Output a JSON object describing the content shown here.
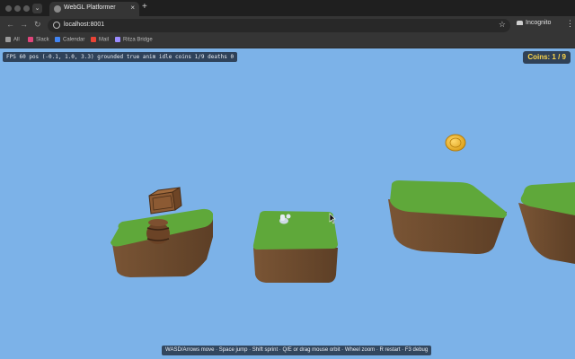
{
  "browser": {
    "tab": {
      "title": "WebGL Platformer",
      "close_glyph": "×"
    },
    "new_tab_glyph": "+",
    "tab_menu_glyph": "⌄",
    "nav": {
      "back": "←",
      "forward": "→",
      "reload": "↻"
    },
    "url": "localhost:8001",
    "star_glyph": "☆",
    "incognito_label": "Incognito",
    "menu_glyph": "⋮",
    "bookmarks": [
      {
        "label": "All",
        "icon": "folder-icon",
        "color": "#9a9a9a"
      },
      {
        "label": "Slack",
        "icon": "slack-icon",
        "color": "#e0457b"
      },
      {
        "label": "Calendar",
        "icon": "calendar-icon",
        "color": "#4285f4"
      },
      {
        "label": "Mail",
        "icon": "gmail-icon",
        "color": "#ea4335"
      },
      {
        "label": "Ritza Bridge",
        "icon": "bridge-icon",
        "color": "#9b8cff"
      }
    ]
  },
  "game": {
    "sky_color": "#7cb2e8",
    "grass_color": "#5fa83a",
    "dirt_color": "#6b4a2e",
    "coin_color": "#f2b41c",
    "debug": {
      "fps_label": "FPS",
      "fps": "60",
      "pos_label": "pos",
      "pos": "(-0.1, 1.0, 3.3)",
      "grounded_label": "grounded",
      "grounded": "true",
      "anim_label": "anim",
      "anim": "idle",
      "coins_label": "coins",
      "coins": "1/9",
      "deaths_label": "deaths",
      "deaths": "0"
    },
    "coins_counter": "Coins: 1 / 9",
    "controls_hint": "WASD/Arrows move · Space jump · Shift sprint · Q/E or drag mouse orbit · Wheel zoom · R restart · F3 debug"
  }
}
